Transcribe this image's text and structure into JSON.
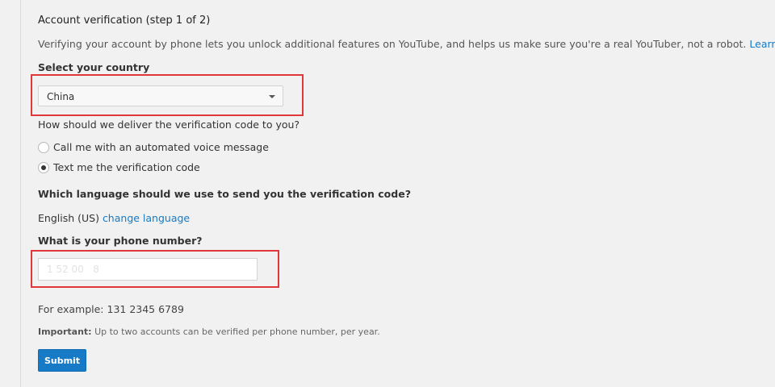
{
  "heading": "Account verification (step 1 of 2)",
  "intro": {
    "text": "Verifying your account by phone lets you unlock additional features on YouTube, and helps us make sure you're a real YouTuber, not a robot.",
    "learn_more": "Learn more"
  },
  "country": {
    "label": "Select your country",
    "selected": "China"
  },
  "delivery": {
    "label": "How should we deliver the verification code to you?",
    "options": [
      {
        "label": "Call me with an automated voice message",
        "checked": false
      },
      {
        "label": "Text me the verification code",
        "checked": true
      }
    ]
  },
  "language": {
    "label": "Which language should we use to send you the verification code?",
    "current": "English (US)",
    "change_link": "change language"
  },
  "phone": {
    "label": "What is your phone number?",
    "value": "1 52 00   8",
    "example": "For example: 131 2345 6789"
  },
  "important": {
    "prefix": "Important:",
    "text": "Up to two accounts can be verified per phone number, per year."
  },
  "submit_label": "Submit",
  "colors": {
    "link": "#167ac6",
    "button": "#167ac6",
    "highlight": "#e0373b",
    "background": "#f1f1f1"
  }
}
